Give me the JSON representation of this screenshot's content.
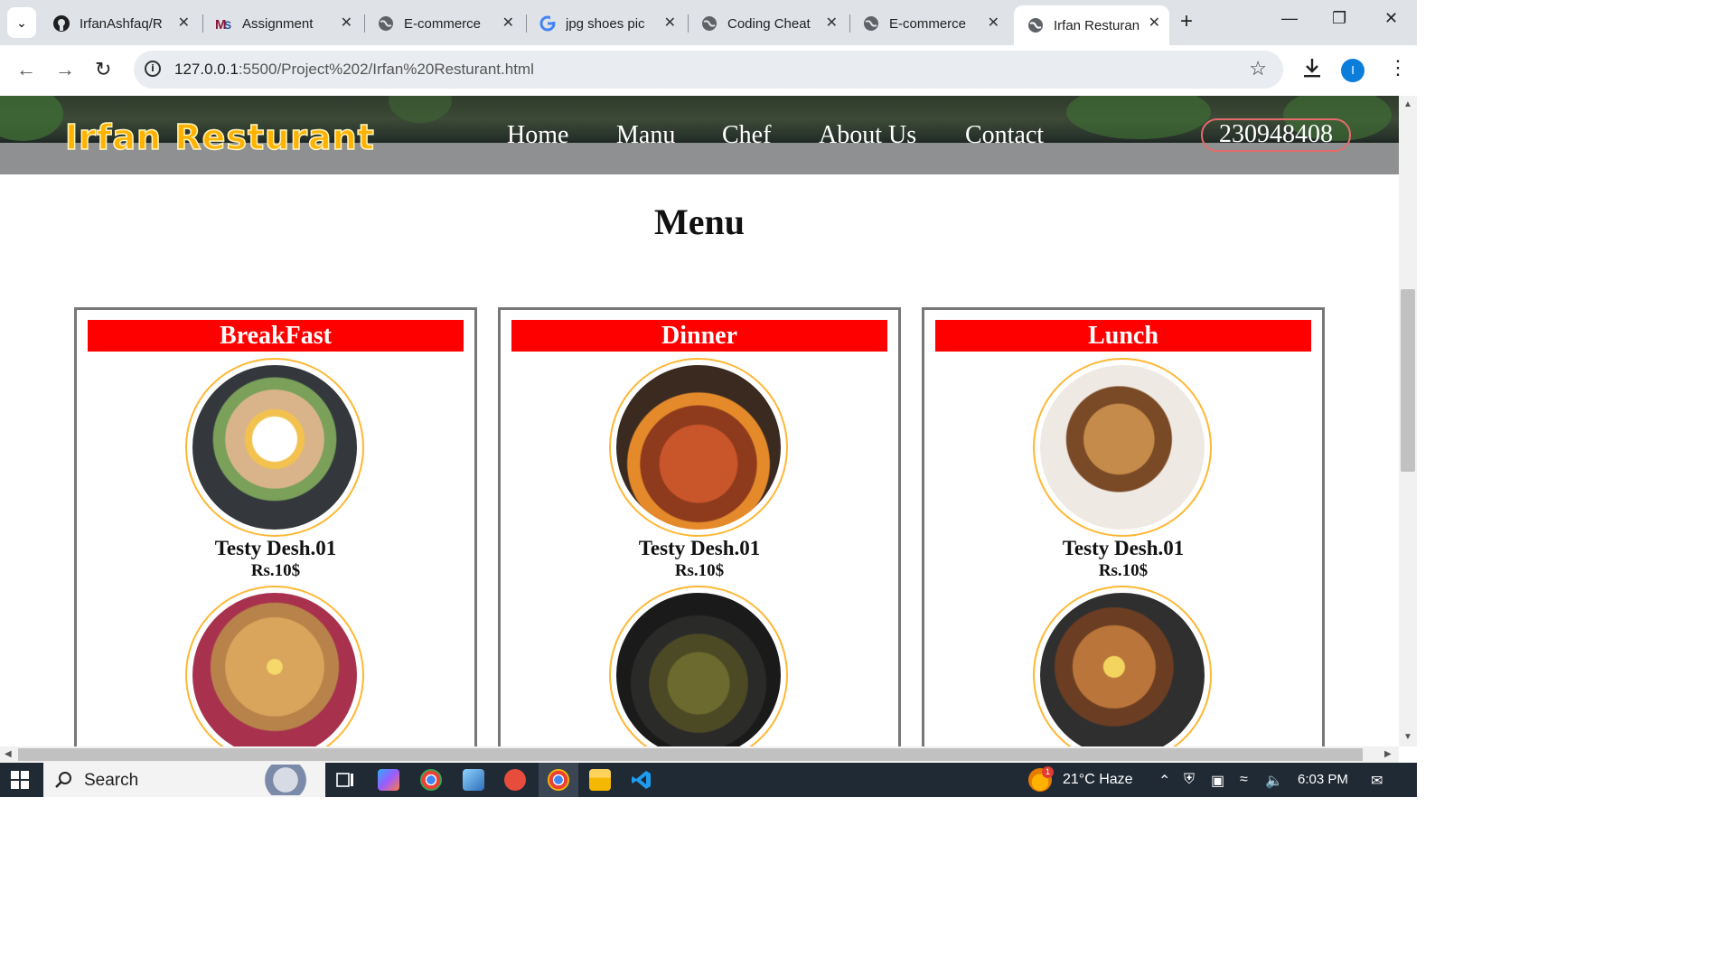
{
  "browser": {
    "tabs": [
      {
        "title": "IrfanAshfaq/R",
        "icon": "github-icon"
      },
      {
        "title": "Assignment",
        "icon": "lms-icon"
      },
      {
        "title": "E-commerce",
        "icon": "globe-icon"
      },
      {
        "title": "jpg shoes pic",
        "icon": "google-icon"
      },
      {
        "title": "Coding Cheat",
        "icon": "globe-icon"
      },
      {
        "title": "E-commerce",
        "icon": "globe-icon"
      },
      {
        "title": "Irfan Resturan",
        "icon": "globe-icon",
        "active": true
      }
    ],
    "url_host": "127.0.0.1",
    "url_path": ":5500/Project%202/Irfan%20Resturant.html",
    "profile_initial": "I"
  },
  "site": {
    "logo": "Irfan Resturant",
    "nav": [
      "Home",
      "Manu",
      "Chef",
      "About Us",
      "Contact"
    ],
    "phone": "230948408"
  },
  "menu": {
    "heading": "Menu",
    "categories": [
      {
        "name": "BreakFast",
        "items": [
          {
            "name": "Testy Desh.01",
            "price": "Rs.10$"
          }
        ]
      },
      {
        "name": "Dinner",
        "items": [
          {
            "name": "Testy Desh.01",
            "price": "Rs.10$"
          }
        ]
      },
      {
        "name": "Lunch",
        "items": [
          {
            "name": "Testy Desh.01",
            "price": "Rs.10$"
          }
        ]
      }
    ]
  },
  "taskbar": {
    "search_label": "Search",
    "weather": "21°C  Haze",
    "weather_badge": "1",
    "time": "6:03 PM"
  },
  "colors": {
    "category_bar": "#ff0000",
    "logo": "#ffb300",
    "dish_ring": "#ffb733",
    "phone_border": "#e46b6b"
  }
}
